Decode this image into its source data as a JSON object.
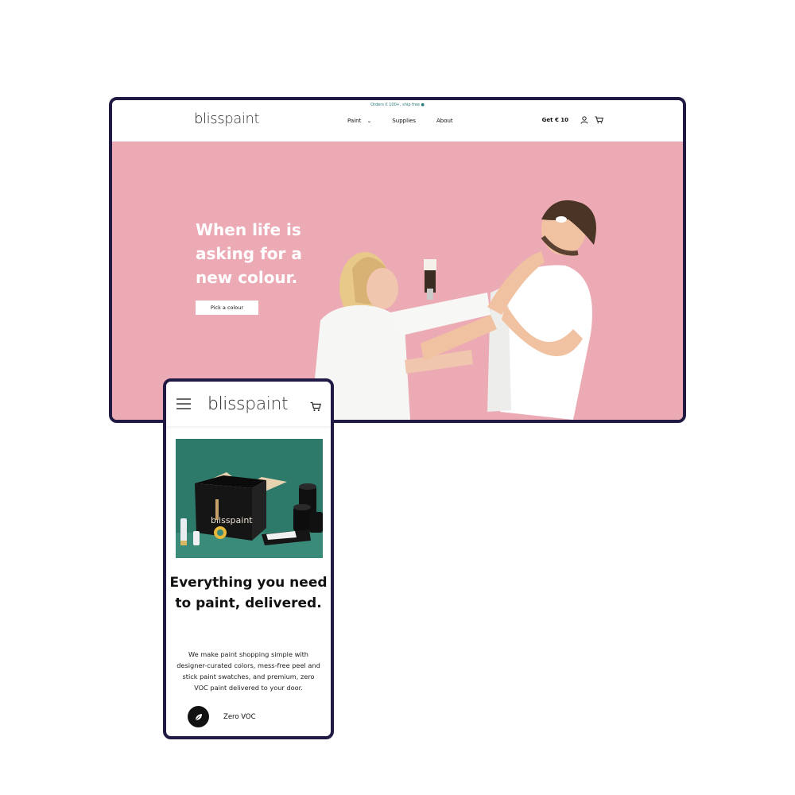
{
  "colors": {
    "frame": "#201a45",
    "hero_background": "#ecaab5",
    "announce_text": "#2a7a78",
    "product_background": "#2e7a6a"
  },
  "desktop": {
    "announcement": "Orders € 100+, ship free ●",
    "logo": {
      "bold": "bliss",
      "light": "paint"
    },
    "nav": [
      {
        "label": "Paint",
        "has_dropdown": true,
        "icon": "chevron-down-icon"
      },
      {
        "label": "Supplies",
        "has_dropdown": false
      },
      {
        "label": "About",
        "has_dropdown": false
      }
    ],
    "promo_label": "Get € 10",
    "icons": {
      "account": "user-icon",
      "cart": "cart-icon"
    },
    "hero": {
      "title": "When life is asking for a new colour.",
      "cta_label": "Pick a colour",
      "image": "couple-painting-photo"
    }
  },
  "mobile": {
    "logo": {
      "bold": "bliss",
      "light": "paint"
    },
    "icons": {
      "menu": "hamburger-menu-icon",
      "cart": "cart-icon"
    },
    "product_image": "paint-box-kit-photo",
    "box_logo": "blisspaint",
    "heading": "Everything you need to paint, delivered.",
    "body": "We make paint shopping simple with designer-curated colors, mess-free peel and stick paint swatches, and premium, zero VOC paint delivered to your door.",
    "feature": {
      "icon": "leaf-icon",
      "label": "Zero VOC"
    }
  }
}
